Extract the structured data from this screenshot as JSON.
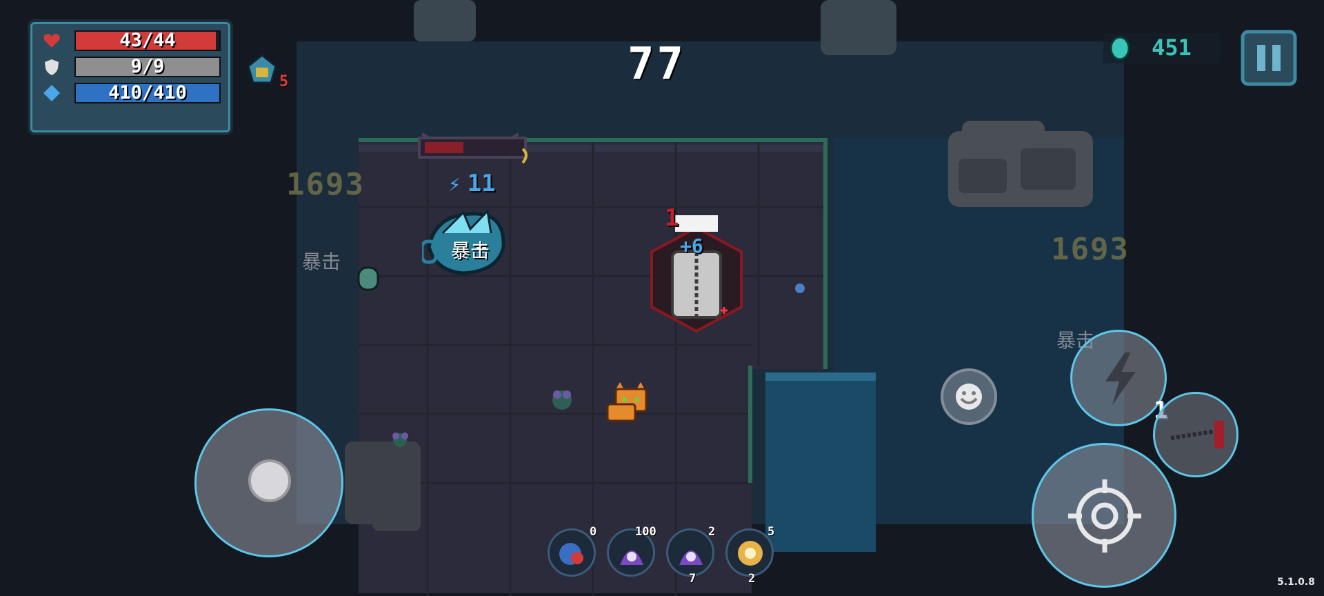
{
  "stats": {
    "hp": {
      "label": "43/44",
      "value": 43,
      "max": 44,
      "color": "#d33b3b"
    },
    "armor": {
      "label": "9/9",
      "value": 9,
      "max": 9,
      "color": "#8f8f8f"
    },
    "energy": {
      "label": "410/410",
      "value": 410,
      "max": 410,
      "color": "#2f72c4"
    }
  },
  "buff": {
    "count": "5"
  },
  "timer": "77",
  "gems": {
    "count": "451",
    "color": "#39c6b8"
  },
  "boss": {
    "energy_label": "11",
    "health_fraction": 0.4
  },
  "floating_texts": {
    "damage_left": "1693",
    "damage_right": "1693",
    "crit_top": "暴击",
    "crit_left": "暴击",
    "crit_right": "暴击",
    "hit_red": "1",
    "plus": "+6"
  },
  "skill": {
    "count": "1"
  },
  "hotbar": [
    {
      "icon": "potion-icon",
      "top_count": "0",
      "bottom_count": ""
    },
    {
      "icon": "purple-creature-icon",
      "top_count": "100",
      "bottom_count": ""
    },
    {
      "icon": "purple-creature-icon",
      "top_count": "2",
      "bottom_count": "7"
    },
    {
      "icon": "blast-icon",
      "top_count": "5",
      "bottom_count": "2"
    }
  ],
  "version": "5.1.0.8",
  "icons": {
    "pause": "pause-icon",
    "emote": "smiley-icon",
    "skill": "lightning-icon",
    "fire": "crosshair-icon",
    "swap": "weapon-swap-icon"
  }
}
